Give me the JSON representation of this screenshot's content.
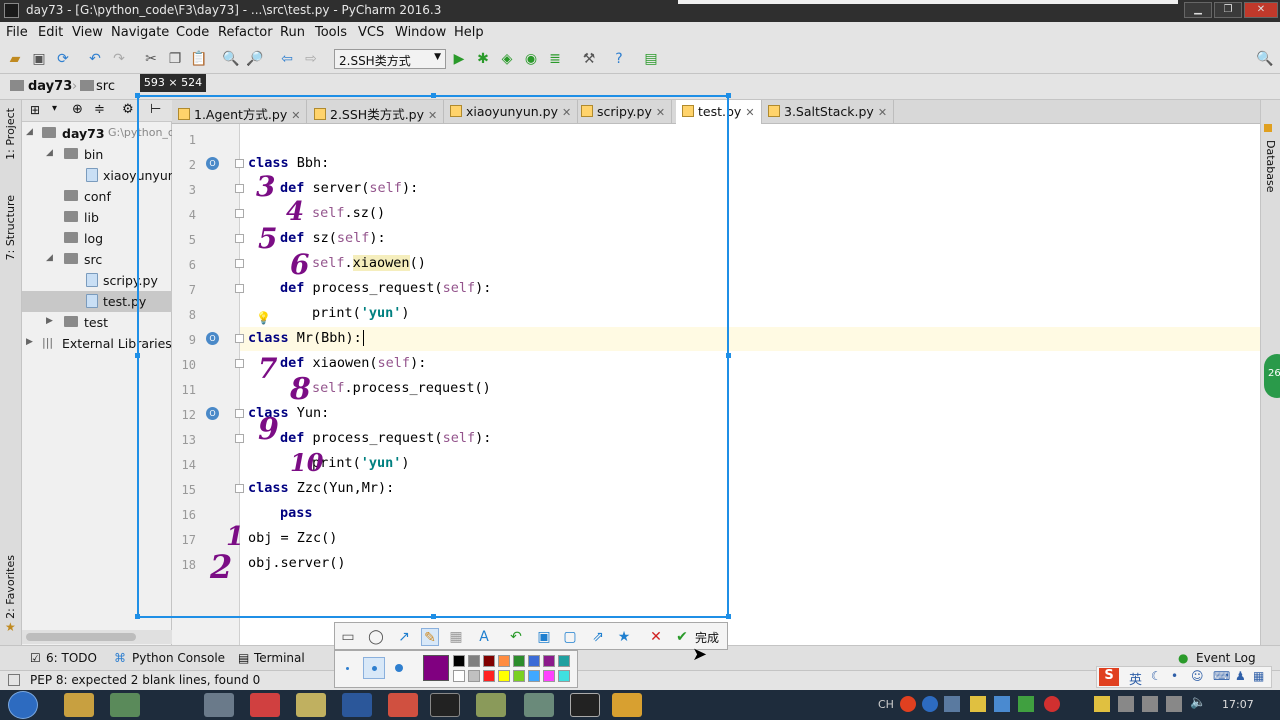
{
  "window": {
    "title": "day73 - [G:\\python_code\\F3\\day73] - ...\\src\\test.py - PyCharm 2016.3"
  },
  "menu": [
    "File",
    "Edit",
    "View",
    "Navigate",
    "Code",
    "Refactor",
    "Run",
    "Tools",
    "VCS",
    "Window",
    "Help"
  ],
  "toolbar": {
    "run_config": "2.SSH类方式"
  },
  "breadcrumb": {
    "project": "day73",
    "folder": "src"
  },
  "selection_size": "593 × 524",
  "side_tools": {
    "project": "1: Project",
    "structure": "7: Structure",
    "favorites": "2: Favorites",
    "database": "Database"
  },
  "project_tree": [
    {
      "label": "day73",
      "path": "G:\\python_c",
      "type": "folder",
      "open": true
    },
    {
      "label": "bin",
      "type": "folder",
      "open": true
    },
    {
      "label": "xiaoyunyun.",
      "type": "file"
    },
    {
      "label": "conf",
      "type": "folder"
    },
    {
      "label": "lib",
      "type": "folder"
    },
    {
      "label": "log",
      "type": "folder"
    },
    {
      "label": "src",
      "type": "folder",
      "open": true
    },
    {
      "label": "scripy.py",
      "type": "file"
    },
    {
      "label": "test.py",
      "type": "file",
      "selected": true
    },
    {
      "label": "test",
      "type": "folder"
    },
    {
      "label": "External Libraries",
      "type": "lib"
    }
  ],
  "tabs": [
    {
      "label": "1.Agent方式.py",
      "active": false
    },
    {
      "label": "2.SSH类方式.py",
      "active": false
    },
    {
      "label": "xiaoyunyun.py",
      "active": false
    },
    {
      "label": "scripy.py",
      "active": false
    },
    {
      "label": "test.py",
      "active": true
    },
    {
      "label": "3.SaltStack.py",
      "active": false
    }
  ],
  "line_numbers": [
    "1",
    "2",
    "3",
    "4",
    "5",
    "6",
    "7",
    "8",
    "9",
    "10",
    "11",
    "12",
    "13",
    "14",
    "15",
    "16",
    "17",
    "18"
  ],
  "code": {
    "l2_kw": "class",
    "l2_rest": " Bbh:",
    "l3_kw": "def",
    "l3_name": " server(",
    "l3_self": "self",
    "l3_end": "):",
    "l4_self": "self",
    "l4_rest": ".sz()",
    "l5_kw": "def",
    "l5_name": " sz(",
    "l5_self": "self",
    "l5_end": "):",
    "l6_self": "self",
    "l6_dot": ".",
    "l6_hl": "xiaowen",
    "l6_end": "()",
    "l7_kw": "def",
    "l7_name": " process_request(",
    "l7_self": "self",
    "l7_end": "):",
    "l8_pre": "print(",
    "l8_str": "'yun'",
    "l8_end": ")",
    "l9_kw": "class",
    "l9_rest": " Mr(Bbh):",
    "l10_kw": "def",
    "l10_name": " xiaowen(",
    "l10_self": "self",
    "l10_end": "):",
    "l11_self": "self",
    "l11_rest": ".process_request()",
    "l12_kw": "class",
    "l12_rest": " Yun:",
    "l13_kw": "def",
    "l13_name": " process_request(",
    "l13_self": "self",
    "l13_end": "):",
    "l14_pre": "print(",
    "l14_str": "'yun'",
    "l14_end": ")",
    "l15_kw": "class",
    "l15_rest": " Zzc(Yun,Mr):",
    "l16_kw": "pass",
    "l17": "obj = Zzc()",
    "l18": "obj.server()"
  },
  "annotations": [
    "3",
    "4",
    "5",
    "6",
    "7",
    "8",
    "9",
    "10",
    "1",
    "2"
  ],
  "annotation_color": "#7b0d85",
  "bottom_tools": {
    "todo": "6: TODO",
    "console": "Python Console",
    "terminal": "Terminal",
    "eventlog": "Event Log"
  },
  "status": {
    "message": "PEP 8: expected 2 blank lines, found 0"
  },
  "snapshot_tool": {
    "done_label": "完成"
  },
  "palette": [
    "#000000",
    "#808080",
    "#800000",
    "#ff8c40",
    "#2c8c2c",
    "#3b6bd6",
    "#8b1a8b",
    "#20a0a0",
    "#ffffff",
    "#c0c0c0",
    "#ff2020",
    "#ffff00",
    "#7ad020",
    "#40a8ff",
    "#ff40ff",
    "#40e0e0"
  ],
  "palette_selected": "#800080",
  "taskbar": {
    "lang": "CH",
    "ime": "英",
    "time": "17:07"
  }
}
